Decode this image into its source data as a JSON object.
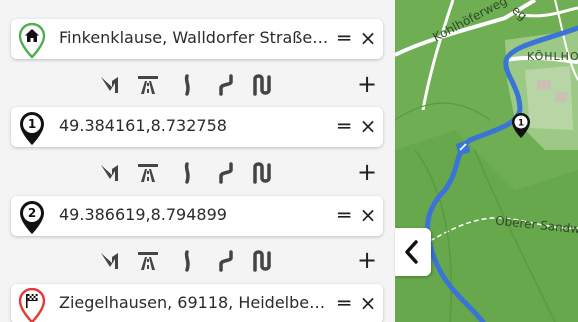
{
  "waypoints": [
    {
      "text": "Finkenklause, Walldorfer Straße, 9...",
      "marker_label": "",
      "marker_kind": "start",
      "marker_icon": "home-icon",
      "marker_color": "#4caf50"
    },
    {
      "text": "49.384161,8.732758",
      "marker_label": "1",
      "marker_kind": "via",
      "marker_color": "#111111"
    },
    {
      "text": "49.386619,8.794899",
      "marker_label": "2",
      "marker_kind": "via",
      "marker_color": "#111111"
    },
    {
      "text": "Ziegelhausen, 69118, Heidelberg, B...",
      "marker_label": "",
      "marker_kind": "end",
      "marker_icon": "flag-icon",
      "marker_color": "#e53935"
    }
  ],
  "waypoint_actions": {
    "drag_label": "═",
    "remove_label": "×"
  },
  "mode_row": {
    "icons": [
      "fastest-route-icon",
      "highway-icon",
      "curvy-route-icon",
      "very-curvy-route-icon",
      "extreme-curvy-route-icon"
    ],
    "add_label": "+"
  },
  "map": {
    "labels": [
      "Kohlhöferweg",
      "KÖHLHO",
      "Oberer Sandw",
      "eg"
    ],
    "via_marker_label": "1",
    "route_color": "#3a74d6",
    "forest_color": "#6fae52"
  },
  "collapse_button": {
    "icon": "chevron-left-icon"
  }
}
